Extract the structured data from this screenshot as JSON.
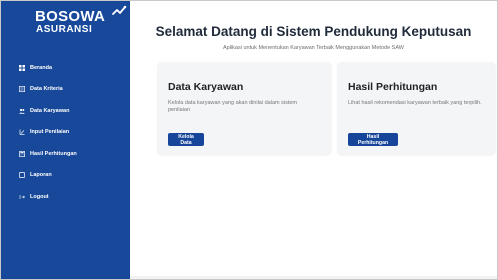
{
  "brand": {
    "name": "BOSOWA",
    "sub": "ASURANSI",
    "colors": {
      "sidebar": "#17489a",
      "button": "#16459a",
      "card": "#f4f5f7"
    }
  },
  "sidebar": {
    "items": [
      {
        "label": "Beranda",
        "icon": "grid-icon"
      },
      {
        "label": "Data Kriteria",
        "icon": "list-icon"
      },
      {
        "label": "Data Karyawan",
        "icon": "users-icon"
      },
      {
        "label": "Input Penilaian",
        "icon": "edit-icon"
      },
      {
        "label": "Hasil Perhitungan",
        "icon": "calculator-icon"
      },
      {
        "label": "Laporan",
        "icon": "report-icon"
      },
      {
        "label": "Logout",
        "icon": "logout-icon"
      }
    ]
  },
  "main": {
    "title": "Selamat Datang di Sistem Pendukung Keputusan",
    "subtitle": "Aplikasi untuk Menentukan Karyawan Terbaik Menggunakan Metode SAW",
    "cards": [
      {
        "title": "Data Karyawan",
        "text": "Kelola data karyawan yang akan dinilai dalam sistem penilaian",
        "button": "Kelola Data"
      },
      {
        "title": "Hasil Perhitungan",
        "text": "Lihat hasil rekomendasi karyawan terbaik yang terpilih.",
        "button": "Hasil Perhitungan"
      }
    ]
  }
}
